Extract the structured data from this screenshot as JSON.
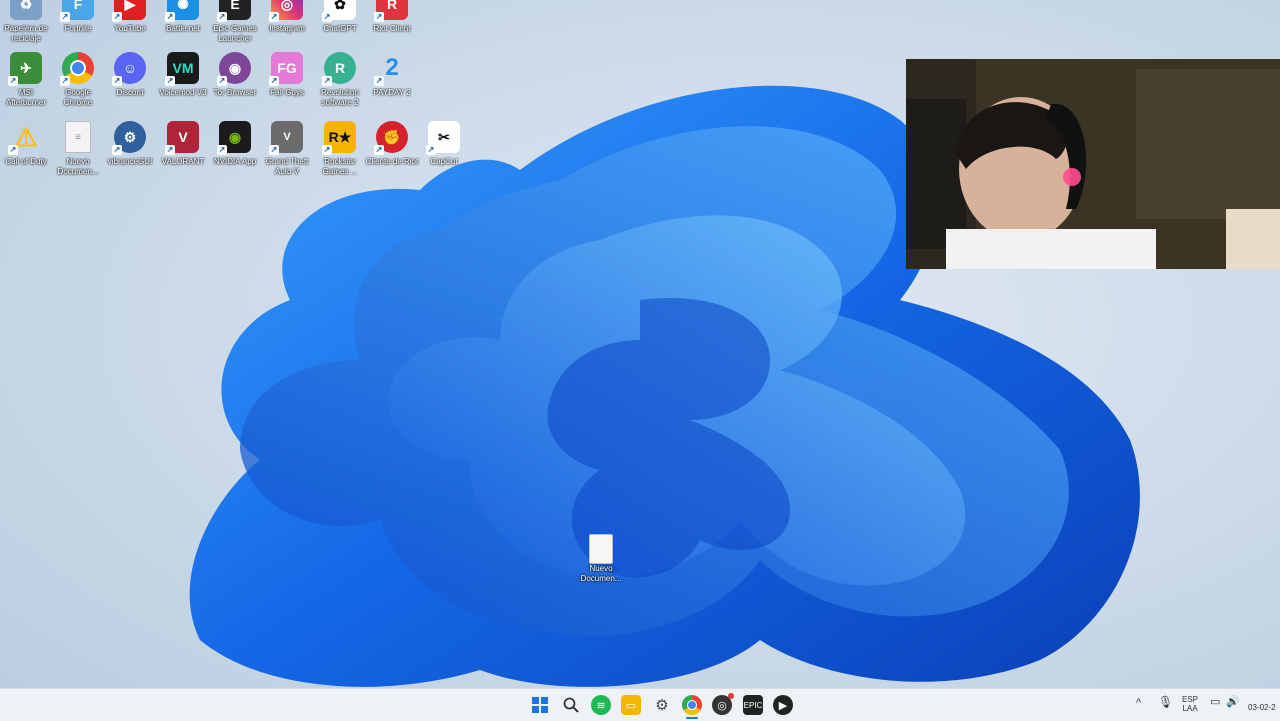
{
  "desktop": {
    "icons": [
      {
        "label": "Papelera de reciclaje",
        "icon": "recycle-bin-icon",
        "color": "#7aa0c8"
      },
      {
        "label": "Fortnite",
        "icon": "fortnite-icon",
        "color": "#49a7e8"
      },
      {
        "label": "YouTube",
        "icon": "youtube-icon",
        "color": "#e02020"
      },
      {
        "label": "Battle.net",
        "icon": "battlenet-icon",
        "color": "#1a8fe3"
      },
      {
        "label": "Epic Games Launcher",
        "icon": "epic-games-icon",
        "color": "#222222"
      },
      {
        "label": "Instagram",
        "icon": "instagram-icon",
        "color": "#d9317a"
      },
      {
        "label": "ChatGPT",
        "icon": "chatgpt-icon",
        "color": "#ffffff"
      },
      {
        "label": "Riot Client",
        "icon": "riot-icon",
        "color": "#e2343f"
      },
      {
        "label": "MSI Afterburner",
        "icon": "msi-afterburner-icon",
        "color": "#3c8d3a"
      },
      {
        "label": "Google Chrome",
        "icon": "chrome-icon",
        "color": "#4285f4"
      },
      {
        "label": "Discord",
        "icon": "discord-icon",
        "color": "#5865f2"
      },
      {
        "label": "Voicemod V3",
        "icon": "voicemod-icon",
        "color": "#1a1a1a"
      },
      {
        "label": "Tor Browser",
        "icon": "tor-icon",
        "color": "#7d4698"
      },
      {
        "label": "Fall Guys",
        "icon": "fall-guys-icon",
        "color": "#e37ad8"
      },
      {
        "label": "Revolution software 2",
        "icon": "revolution-icon",
        "color": "#38b092"
      },
      {
        "label": "PAYDAY 2",
        "icon": "payday-icon",
        "color": "#2b8ee6"
      },
      {
        "label": "Call of Duty",
        "icon": "warning-icon",
        "color": "#f4c20d"
      },
      {
        "label": "Nuevo Documen...",
        "icon": "document-icon",
        "color": "#f3f3f3"
      },
      {
        "label": "vibranceGUI",
        "icon": "gear-icon",
        "color": "#2f5f9c"
      },
      {
        "label": "VALORANT",
        "icon": "valorant-icon",
        "color": "#b0243a"
      },
      {
        "label": "NVIDIA App",
        "icon": "nvidia-icon",
        "color": "#1b1b1b"
      },
      {
        "label": "Grand Theft Auto V",
        "icon": "gta-icon",
        "color": "#6b6b6b"
      },
      {
        "label": "Rockstar Games ...",
        "icon": "rockstar-icon",
        "color": "#f6b400"
      },
      {
        "label": "Cliente de Riot",
        "icon": "riot-fist-icon",
        "color": "#d6222c"
      },
      {
        "label": "CapCut",
        "icon": "capcut-icon",
        "color": "#ffffff"
      }
    ],
    "center_file": {
      "label": "Nuevo Documen...",
      "icon": "document-icon"
    }
  },
  "taskbar": {
    "apps": [
      {
        "name": "start-button",
        "icon": "windows-icon",
        "color": "#1a73e8"
      },
      {
        "name": "search-button",
        "icon": "search-icon",
        "color": "#333333"
      },
      {
        "name": "spotify",
        "icon": "spotify-icon",
        "color": "#1db954"
      },
      {
        "name": "file-explorer",
        "icon": "folder-icon",
        "color": "#f2b705"
      },
      {
        "name": "settings",
        "icon": "gear-icon",
        "color": "#555555"
      },
      {
        "name": "chrome",
        "icon": "chrome-icon",
        "color": "#4285f4"
      },
      {
        "name": "obs",
        "icon": "obs-icon",
        "color": "#333333"
      },
      {
        "name": "epic-games",
        "icon": "epic-games-icon",
        "color": "#222222"
      },
      {
        "name": "media-player",
        "icon": "play-icon",
        "color": "#222222"
      }
    ],
    "tray": {
      "chevron": "^",
      "lang_top": "ESP",
      "lang_bottom": "LAA",
      "date": "03-02-2"
    }
  }
}
